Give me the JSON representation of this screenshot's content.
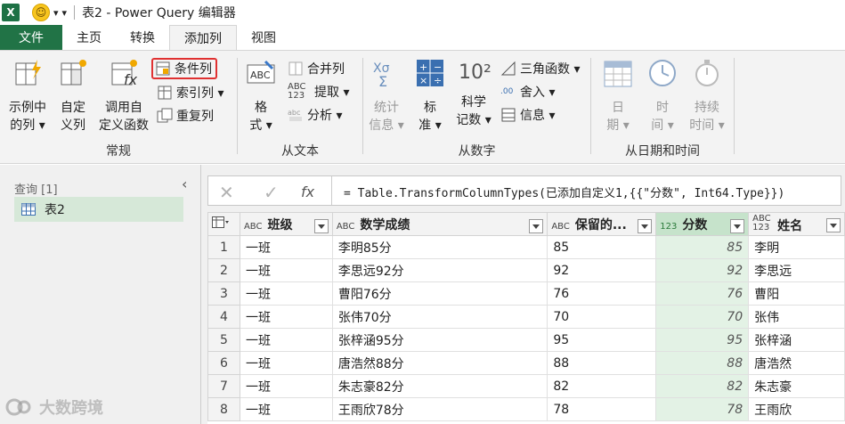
{
  "app": {
    "title": "表2 - Power Query 编辑器",
    "excel_letter": "X"
  },
  "tabs": [
    "文件",
    "主页",
    "转换",
    "添加列",
    "视图"
  ],
  "ribbon": {
    "general": {
      "label": "常规",
      "btn1": [
        "示例中",
        "的列 ▾"
      ],
      "btn2": [
        "自定",
        "义列"
      ],
      "btn3": [
        "调用自",
        "定义函数"
      ],
      "cond": "条件列",
      "index": "索引列 ▾",
      "dup": "重复列"
    },
    "text": {
      "label": "从文本",
      "format": [
        "格",
        "式 ▾"
      ],
      "merge": "合并列",
      "extract": "提取 ▾",
      "abc123": "ABC 123",
      "parse": "分析 ▾"
    },
    "number": {
      "label": "从数字",
      "stats": [
        "统计",
        "信息 ▾"
      ],
      "standard": [
        "标",
        "准 ▾"
      ],
      "sci": [
        "科学",
        "记数 ▾"
      ],
      "sci_icon": "10²",
      "trig": "三角函数 ▾",
      "round": "舍入 ▾",
      "info": "信息 ▾"
    },
    "datetime": {
      "label": "从日期和时间",
      "date": [
        "日",
        "期 ▾"
      ],
      "time": [
        "时",
        "间 ▾"
      ],
      "duration": [
        "持续",
        "时间 ▾"
      ]
    }
  },
  "queries": {
    "header": "查询 [1]",
    "item": "表2"
  },
  "formula": "= Table.TransformColumnTypes(已添加自定义1,{{\"分数\", Int64.Type}})",
  "grid": {
    "headers": [
      {
        "type": "ABC",
        "name": "班级"
      },
      {
        "type": "ABC",
        "name": "数学成绩"
      },
      {
        "type": "ABC",
        "name": "保留的..."
      },
      {
        "type": "123",
        "name": "分数"
      },
      {
        "type": "ABC 123",
        "name": "姓名"
      }
    ],
    "rows": [
      [
        "1",
        "一班",
        "李明85分",
        "85",
        "85",
        "李明"
      ],
      [
        "2",
        "一班",
        "李思远92分",
        "92",
        "92",
        "李思远"
      ],
      [
        "3",
        "一班",
        "曹阳76分",
        "76",
        "76",
        "曹阳"
      ],
      [
        "4",
        "一班",
        "张伟70分",
        "70",
        "70",
        "张伟"
      ],
      [
        "5",
        "一班",
        "张梓涵95分",
        "95",
        "95",
        "张梓涵"
      ],
      [
        "6",
        "一班",
        "唐浩然88分",
        "88",
        "88",
        "唐浩然"
      ],
      [
        "7",
        "一班",
        "朱志豪82分",
        "82",
        "82",
        "朱志豪"
      ],
      [
        "8",
        "一班",
        "王雨欣78分",
        "78",
        "78",
        "王雨欣"
      ]
    ]
  },
  "watermark": "大数跨境",
  "colors": {
    "file_tab": "#217346",
    "highlight_border": "#e03131",
    "selected_col": "#c6e3cb"
  }
}
